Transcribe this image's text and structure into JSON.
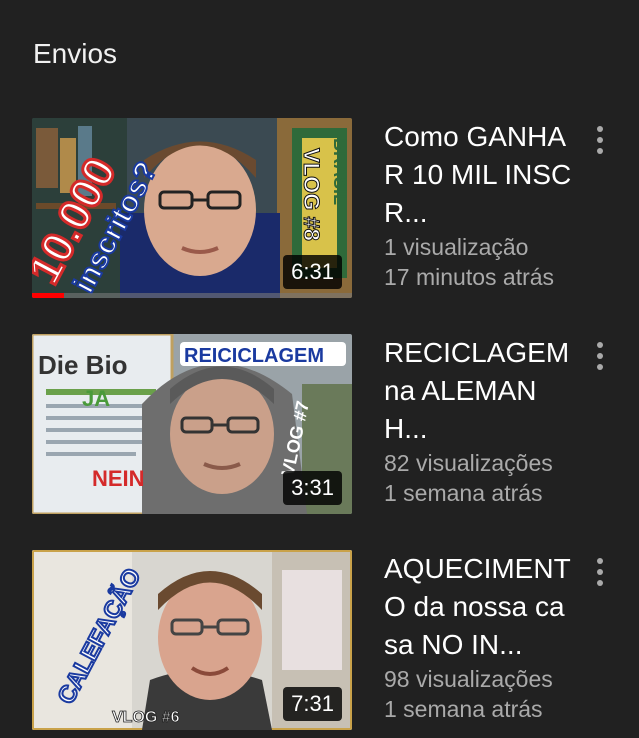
{
  "section": {
    "title": "Envios"
  },
  "videos": [
    {
      "title": "Como GANHAR 10 MIL INSCR...",
      "views": "1 visualização",
      "age": "17 minutos atrás",
      "duration": "6:31",
      "watched_progress": 0.1,
      "thumb_text": [
        "10.000",
        "inscritos?",
        "VLOG #8",
        "BRASIL"
      ]
    },
    {
      "title": "RECICLAGEM na ALEMANH...",
      "views": "82 visualizações",
      "age": "1 semana atrás",
      "duration": "3:31",
      "thumb_text": [
        "REICICLAGEM",
        "Die Bio",
        "JA",
        "NEIN",
        "VLOG #7"
      ]
    },
    {
      "title": "AQUECIMENTO da nossa casa NO IN...",
      "views": "98 visualizações",
      "age": "1 semana atrás",
      "duration": "7:31",
      "thumb_text": [
        "CALEFAÇÃO",
        "VLOG #6"
      ]
    }
  ],
  "colors": {
    "background": "#212121",
    "secondary_text": "#aaaaaa",
    "progress": "#ff0000"
  },
  "icons": {
    "more": "more-vert-icon"
  }
}
